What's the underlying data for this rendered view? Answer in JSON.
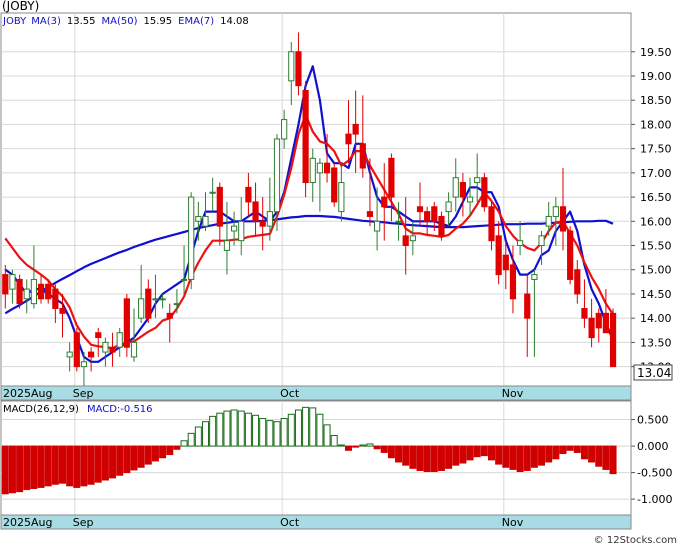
{
  "symbol": "(JOBY)",
  "price_legend": {
    "ticker": "JOBY",
    "ma3_label": "MA(3)",
    "ma3_value": "13.55",
    "ma50_label": "MA(50)",
    "ma50_value": "15.95",
    "ema7_label": "EMA(7)",
    "ema7_value": "14.08"
  },
  "macd_legend": {
    "params_label": "MACD(26,12,9)",
    "value_label": "MACD:-0.516"
  },
  "last_price": "13.04",
  "watermark": "© 12Stocks.com",
  "colors": {
    "up_candle": "#2e7d32",
    "down_candle": "#e00000",
    "ema": "#ee1111",
    "ma": "#1010d0",
    "band": "#a8dce4",
    "grid": "#d8d8d8",
    "macd_pos": "#1a6b1a",
    "macd_neg": "#d00000"
  },
  "chart_data": [
    {
      "type": "candlestick",
      "y_ticks": [
        "13.00",
        "13.50",
        "14.00",
        "14.50",
        "15.00",
        "15.50",
        "16.00",
        "16.50",
        "17.00",
        "17.50",
        "18.00",
        "18.50",
        "19.00",
        "19.50"
      ],
      "ylim": [
        12.6,
        20.3
      ],
      "x_labels": [
        "2025Aug",
        "Sep",
        "Oct",
        "Nov"
      ],
      "x_label_index": [
        0,
        10,
        39,
        70
      ],
      "candles": [
        [
          14.9,
          15.1,
          14.2,
          14.5
        ],
        [
          14.6,
          15.0,
          14.3,
          14.9
        ],
        [
          14.8,
          14.9,
          14.2,
          14.3
        ],
        [
          14.4,
          14.8,
          14.1,
          14.6
        ],
        [
          14.3,
          15.5,
          14.2,
          14.8
        ],
        [
          14.7,
          14.9,
          14.3,
          14.4
        ],
        [
          14.7,
          14.8,
          14.3,
          14.4
        ],
        [
          14.6,
          14.7,
          13.9,
          14.2
        ],
        [
          14.2,
          14.5,
          13.6,
          14.1
        ],
        [
          13.2,
          13.5,
          12.9,
          13.3
        ],
        [
          13.7,
          13.8,
          12.9,
          13.0
        ],
        [
          13.0,
          13.3,
          12.6,
          13.1
        ],
        [
          13.3,
          13.4,
          12.9,
          13.2
        ],
        [
          13.7,
          13.8,
          13.2,
          13.6
        ],
        [
          13.3,
          13.6,
          13.0,
          13.5
        ],
        [
          13.4,
          13.7,
          13.0,
          13.3
        ],
        [
          13.4,
          13.8,
          13.2,
          13.7
        ],
        [
          14.4,
          14.5,
          13.2,
          13.4
        ],
        [
          13.2,
          14.2,
          13.1,
          13.5
        ],
        [
          14.0,
          15.1,
          13.9,
          14.4
        ],
        [
          14.6,
          14.8,
          13.9,
          14.0
        ],
        [
          14.4,
          14.9,
          14.0,
          14.4
        ],
        [
          14.4,
          14.5,
          14.2,
          14.4
        ],
        [
          14.1,
          14.3,
          13.5,
          14.0
        ],
        [
          14.3,
          14.6,
          14.1,
          14.3
        ],
        [
          14.8,
          15.5,
          14.5,
          14.8
        ],
        [
          14.8,
          16.6,
          14.6,
          16.5
        ],
        [
          16.0,
          16.4,
          15.6,
          16.1
        ],
        [
          15.9,
          16.6,
          15.8,
          16.1
        ],
        [
          16.6,
          16.9,
          16.2,
          16.6
        ],
        [
          16.7,
          16.8,
          15.5,
          15.9
        ],
        [
          15.4,
          16.4,
          14.9,
          15.6
        ],
        [
          15.8,
          16.2,
          15.5,
          15.9
        ],
        [
          15.6,
          16.5,
          15.3,
          16.0
        ],
        [
          16.7,
          17.0,
          16.1,
          16.4
        ],
        [
          16.4,
          16.8,
          15.7,
          16.0
        ],
        [
          16.0,
          16.5,
          15.4,
          15.9
        ],
        [
          15.9,
          16.9,
          15.6,
          16.2
        ],
        [
          16.2,
          17.8,
          15.8,
          17.7
        ],
        [
          17.7,
          18.3,
          17.5,
          18.1
        ],
        [
          18.9,
          19.7,
          18.4,
          19.5
        ],
        [
          19.5,
          19.9,
          18.6,
          18.8
        ],
        [
          18.7,
          18.9,
          16.5,
          16.8
        ],
        [
          16.8,
          17.5,
          16.4,
          17.3
        ],
        [
          17.0,
          17.3,
          16.2,
          17.2
        ],
        [
          17.2,
          17.8,
          16.8,
          17.0
        ],
        [
          17.1,
          17.2,
          16.3,
          16.4
        ],
        [
          16.2,
          17.2,
          16.0,
          16.8
        ],
        [
          17.8,
          18.5,
          17.2,
          17.6
        ],
        [
          18.0,
          18.7,
          17.0,
          17.8
        ],
        [
          17.6,
          18.6,
          16.9,
          17.1
        ],
        [
          16.2,
          17.3,
          15.9,
          16.1
        ],
        [
          15.8,
          16.7,
          15.4,
          16.0
        ],
        [
          16.5,
          17.2,
          15.6,
          16.3
        ],
        [
          17.3,
          17.4,
          16.0,
          16.5
        ],
        [
          16.0,
          16.4,
          15.6,
          16.0
        ],
        [
          15.7,
          16.5,
          14.9,
          15.5
        ],
        [
          15.6,
          16.0,
          15.3,
          15.7
        ],
        [
          16.3,
          16.8,
          15.9,
          16.2
        ],
        [
          16.2,
          16.3,
          15.7,
          16.0
        ],
        [
          16.3,
          16.4,
          15.8,
          16.0
        ],
        [
          16.1,
          16.2,
          15.6,
          15.7
        ],
        [
          16.2,
          16.6,
          15.9,
          16.4
        ],
        [
          16.5,
          17.3,
          16.2,
          16.9
        ],
        [
          16.8,
          17.0,
          16.1,
          16.5
        ],
        [
          16.4,
          16.9,
          16.1,
          16.5
        ],
        [
          16.8,
          17.4,
          16.4,
          16.9
        ],
        [
          16.9,
          17.0,
          16.2,
          16.3
        ],
        [
          16.3,
          16.4,
          15.4,
          15.6
        ],
        [
          15.7,
          16.0,
          14.7,
          14.9
        ],
        [
          15.3,
          15.6,
          14.6,
          15.0
        ],
        [
          15.1,
          15.5,
          14.1,
          14.4
        ],
        [
          15.5,
          16.0,
          15.3,
          15.6
        ],
        [
          14.5,
          14.9,
          13.2,
          14.0
        ],
        [
          14.8,
          15.0,
          13.2,
          14.9
        ],
        [
          15.5,
          15.8,
          15.1,
          15.7
        ],
        [
          15.9,
          16.4,
          15.7,
          16.1
        ],
        [
          16.1,
          16.5,
          15.5,
          16.3
        ],
        [
          16.3,
          17.1,
          15.4,
          15.8
        ],
        [
          15.8,
          15.9,
          14.7,
          14.8
        ],
        [
          15.0,
          15.2,
          14.3,
          14.5
        ],
        [
          14.2,
          14.8,
          13.8,
          14.0
        ],
        [
          14.0,
          14.4,
          13.4,
          13.6
        ],
        [
          14.1,
          14.2,
          13.5,
          13.8
        ],
        [
          14.1,
          14.6,
          13.7,
          13.7
        ],
        [
          14.1,
          14.2,
          13.0,
          13.0
        ]
      ],
      "ema7": [
        15.65,
        15.45,
        15.25,
        15.1,
        15.0,
        14.9,
        14.78,
        14.6,
        14.45,
        14.22,
        13.85,
        13.62,
        13.45,
        13.42,
        13.4,
        13.38,
        13.45,
        13.5,
        13.52,
        13.62,
        13.72,
        13.8,
        13.95,
        14.0,
        14.2,
        14.45,
        14.85,
        15.15,
        15.4,
        15.6,
        15.6,
        15.6,
        15.62,
        15.63,
        15.68,
        15.7,
        15.72,
        15.74,
        16.1,
        16.55,
        17.1,
        17.8,
        18.2,
        17.85,
        17.65,
        17.6,
        17.45,
        17.15,
        17.25,
        17.45,
        17.45,
        17.15,
        16.9,
        16.65,
        16.4,
        16.15,
        15.85,
        15.75,
        15.75,
        15.72,
        15.7,
        15.68,
        15.72,
        15.85,
        15.95,
        16.12,
        16.35,
        16.6,
        16.42,
        16.2,
        15.9,
        15.7,
        15.55,
        15.45,
        15.4,
        15.55,
        15.8,
        15.98,
        16.0,
        15.75,
        15.5,
        15.15,
        14.85,
        14.6,
        14.3,
        14.08
      ],
      "ma3": [
        15.0,
        14.9,
        14.7,
        14.5,
        14.6,
        14.6,
        14.5,
        14.4,
        14.3,
        14.0,
        13.6,
        13.2,
        13.1,
        13.1,
        13.2,
        13.3,
        13.4,
        13.5,
        13.6,
        13.8,
        14.0,
        14.3,
        14.5,
        14.6,
        14.7,
        14.8,
        15.3,
        15.8,
        16.2,
        16.2,
        16.2,
        16.1,
        16.0,
        16.0,
        16.1,
        16.2,
        16.1,
        16.0,
        16.2,
        16.6,
        17.3,
        18.0,
        18.8,
        19.2,
        18.5,
        17.4,
        17.2,
        17.2,
        17.1,
        17.6,
        17.6,
        17.0,
        16.5,
        16.3,
        16.3,
        16.2,
        16.1,
        16.0,
        16.0,
        16.0,
        16.0,
        15.95,
        15.9,
        16.1,
        16.4,
        16.7,
        16.7,
        16.6,
        16.6,
        16.3,
        15.6,
        15.2,
        14.9,
        14.9,
        15.0,
        15.3,
        15.4,
        15.8,
        16.0,
        16.2,
        15.8,
        15.1,
        14.6,
        14.3,
        13.9,
        13.55
      ],
      "ma50": [
        14.1,
        14.19,
        14.27,
        14.36,
        14.45,
        14.55,
        14.64,
        14.73,
        14.81,
        14.89,
        14.97,
        15.05,
        15.12,
        15.18,
        15.24,
        15.3,
        15.36,
        15.41,
        15.47,
        15.52,
        15.57,
        15.62,
        15.66,
        15.7,
        15.74,
        15.78,
        15.82,
        15.86,
        15.89,
        15.92,
        15.95,
        15.97,
        15.99,
        16.0,
        16.0,
        16.0,
        16.01,
        16.02,
        16.04,
        16.06,
        16.08,
        16.09,
        16.11,
        16.11,
        16.11,
        16.1,
        16.09,
        16.07,
        16.05,
        16.03,
        16.01,
        16.0,
        15.99,
        15.98,
        15.96,
        15.95,
        15.93,
        15.92,
        15.91,
        15.9,
        15.89,
        15.88,
        15.88,
        15.88,
        15.88,
        15.89,
        15.9,
        15.91,
        15.92,
        15.93,
        15.94,
        15.94,
        15.94,
        15.95,
        15.95,
        15.95,
        15.96,
        15.97,
        15.98,
        15.99,
        16.0,
        16.0,
        16.0,
        16.01,
        16.01,
        15.95
      ]
    },
    {
      "type": "bar",
      "title": "MACD(26,12,9)",
      "y_ticks": [
        "0.500",
        "0.000",
        "-0.500",
        "-1.000"
      ],
      "ylim": [
        -1.3,
        0.85
      ],
      "values": [
        -0.9,
        -0.88,
        -0.86,
        -0.82,
        -0.8,
        -0.78,
        -0.75,
        -0.72,
        -0.7,
        -0.75,
        -0.78,
        -0.75,
        -0.72,
        -0.68,
        -0.64,
        -0.6,
        -0.55,
        -0.5,
        -0.45,
        -0.4,
        -0.34,
        -0.28,
        -0.22,
        -0.16,
        -0.06,
        0.1,
        0.24,
        0.36,
        0.46,
        0.56,
        0.62,
        0.66,
        0.68,
        0.66,
        0.62,
        0.58,
        0.52,
        0.48,
        0.46,
        0.52,
        0.6,
        0.68,
        0.73,
        0.72,
        0.6,
        0.4,
        0.2,
        0.02,
        -0.08,
        -0.02,
        0.02,
        0.04,
        -0.05,
        -0.12,
        -0.22,
        -0.3,
        -0.36,
        -0.42,
        -0.46,
        -0.48,
        -0.48,
        -0.46,
        -0.42,
        -0.36,
        -0.32,
        -0.26,
        -0.2,
        -0.18,
        -0.26,
        -0.34,
        -0.4,
        -0.44,
        -0.48,
        -0.46,
        -0.4,
        -0.36,
        -0.3,
        -0.24,
        -0.14,
        -0.08,
        -0.12,
        -0.24,
        -0.3,
        -0.38,
        -0.44,
        -0.52
      ]
    }
  ]
}
